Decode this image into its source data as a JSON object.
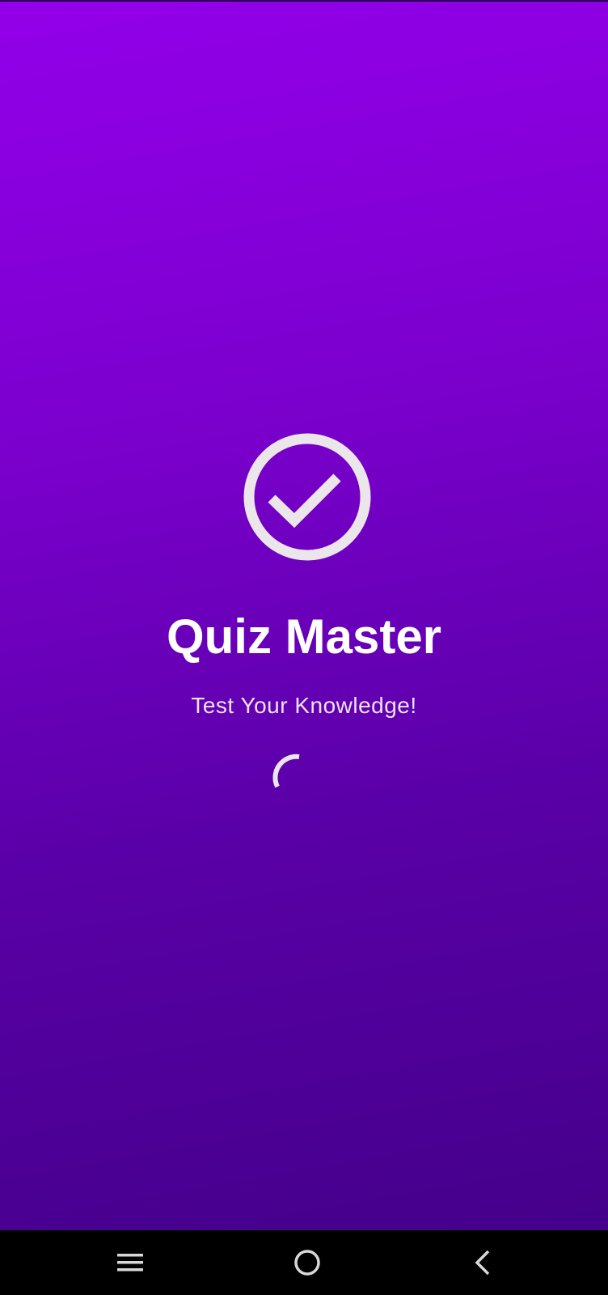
{
  "app": {
    "title": "Quiz Master",
    "subtitle": "Test Your Knowledge!"
  },
  "logo": {
    "icon": "check-circle-icon",
    "color": "#ebe6ea"
  },
  "loading": {
    "icon": "loading-spinner-icon",
    "color": "#ebe6ea"
  },
  "colors": {
    "gradient_top": "#9300ea",
    "gradient_bottom": "#44008a",
    "navbar": "#000000"
  },
  "navigation_bar": {
    "buttons": [
      {
        "icon": "menu-icon"
      },
      {
        "icon": "home-circle-icon"
      },
      {
        "icon": "back-chevron-icon"
      }
    ]
  }
}
